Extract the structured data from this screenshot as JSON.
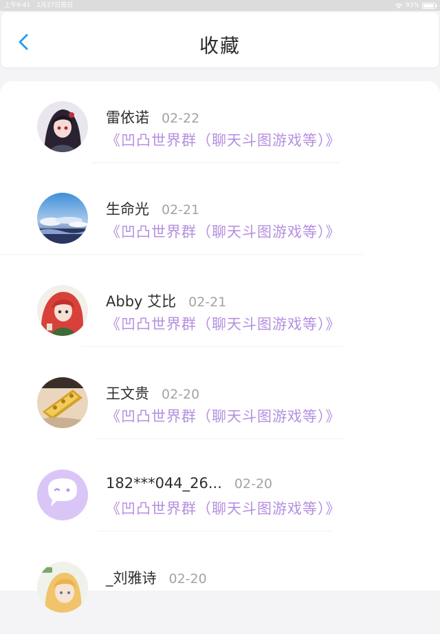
{
  "status_bar": {
    "time": "上午9:41",
    "date": "2月27日周日",
    "battery": "93%",
    "battery_level": 0.93
  },
  "header": {
    "title": "收藏",
    "back_icon": "chevron-left-icon",
    "accent_color": "#2b9bf0"
  },
  "colors": {
    "group_text": "#b48fe0",
    "date_text": "#a3a3a3"
  },
  "favorites": [
    {
      "name": "雷依诺",
      "date": "02-22",
      "group": "《凹凸世界群（聊天斗图游戏等）》",
      "avatar": "anime-girl-dark-hair-avatar"
    },
    {
      "name": "生命光",
      "date": "02-21",
      "group": "《凹凸世界群（聊天斗图游戏等）》",
      "avatar": "sky-clouds-avatar"
    },
    {
      "name": "Abby 艾比",
      "date": "02-21",
      "group": "《凹凸世界群（聊天斗图游戏等）》",
      "avatar": "anime-girl-red-hair-avatar"
    },
    {
      "name": "王文贵",
      "date": "02-20",
      "group": "《凹凸世界群（聊天斗图游戏等）》",
      "avatar": "golden-bracelet-avatar"
    },
    {
      "name": "182***044_26...",
      "date": "02-20",
      "group": "《凹凸世界群（聊天斗图游戏等）》",
      "avatar": "default-chat-bubble-avatar"
    },
    {
      "name": "_刘雅诗",
      "date": "02-20",
      "group": "",
      "avatar": "anime-boy-blond-avatar"
    }
  ]
}
